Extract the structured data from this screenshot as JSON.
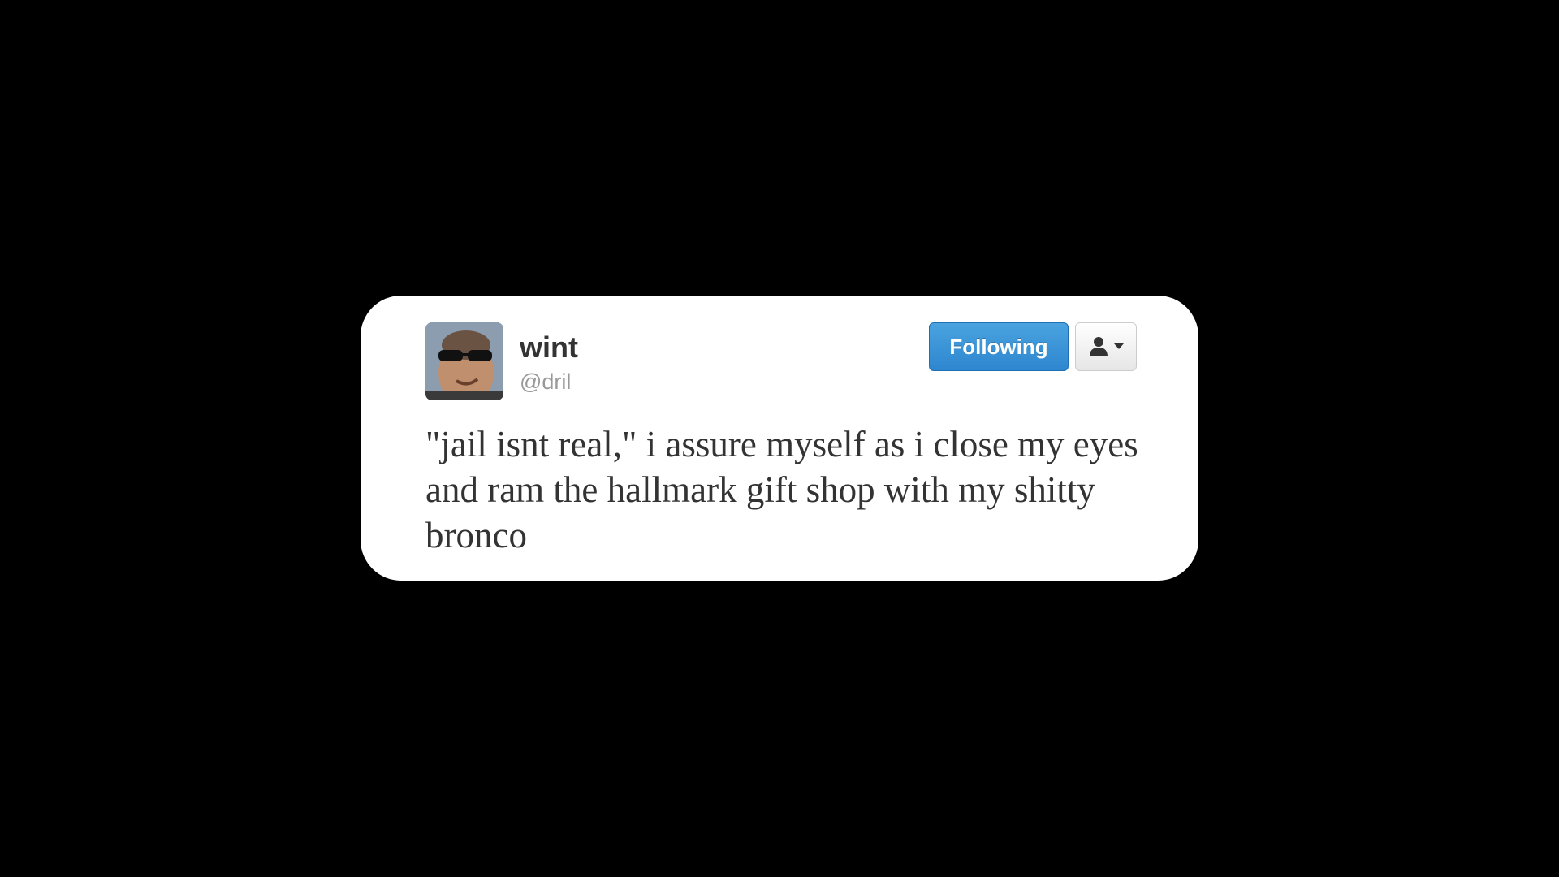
{
  "tweet": {
    "display_name": "wint",
    "handle": "@dril",
    "text": "\"jail isnt real,\" i assure myself as i close my eyes and ram the hallmark gift shop with my shitty bronco",
    "follow_button_label": "Following",
    "avatar_icon": "profile-photo",
    "user_actions_icon": "person-icon"
  },
  "colors": {
    "background": "#000000",
    "card": "#ffffff",
    "follow_button": "#2e86cf",
    "name_text": "#333333",
    "handle_text": "#999999"
  }
}
